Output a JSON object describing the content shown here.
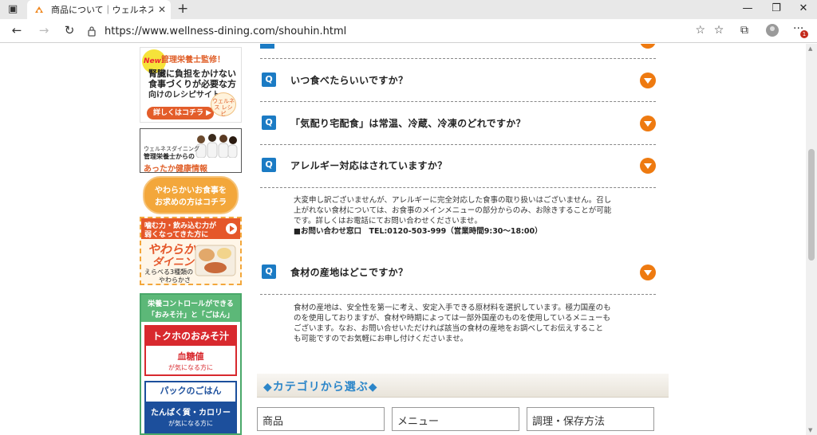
{
  "browser": {
    "tab_title": "商品について｜ウェルネスダイニング",
    "url": "https://www.wellness-dining.com/shouhin.html",
    "notification_count": "1"
  },
  "sidebar": {
    "banner1": {
      "new": "New!",
      "line1": "管理栄養士監修！",
      "line2": "腎臓に負担をかけない",
      "line3": "食事づくりが必要な方",
      "line4": "向けのレシピサイト",
      "button": "詳しくはコチラ ▶",
      "logo": "ウェルネス レシピ"
    },
    "banner2": {
      "line1": "ウェルネスダイニング",
      "line2": "管理栄養士からの",
      "line3": "あったか健康情報"
    },
    "banner3": {
      "line1": "やわらかいお食事を",
      "line2": "お求めの方はコチラ"
    },
    "banner4": {
      "head1": "噛む力・飲み込む力が",
      "head2": "弱くなってきた方に",
      "big1": "やわらか",
      "big2": "ダイニング",
      "sub1": "えらべる3種類の",
      "sub2": "やわらかさ"
    },
    "banner5": {
      "head1": "栄養コントロールができる",
      "head2": "「おみそ汁」と「ごはん」",
      "red_title": "トクホのおみそ汁",
      "red_line1": "血糖値",
      "red_line2": "が気になる方に",
      "blue_title": "パックのごはん",
      "blue_line1": "たんぱく質・カロリー",
      "blue_line2": "が気になる方に"
    }
  },
  "faq": {
    "q_label": "Q",
    "items": [
      {
        "question": "いつ食べたらいいですか？"
      },
      {
        "question": "「気配り宅配食」は常温、冷蔵、冷凍のどれですか？"
      },
      {
        "question": "アレルギー対応はされていますか？",
        "answer_l1": "大変申し訳ございませんが、アレルギーに完全対応した食事の取り扱いはございません。召し",
        "answer_l2": "上がれない食材については、お食事のメインメニューの部分からのみ、お除きすることが可能",
        "answer_l3": "です。詳しくはお電話にてお問い合わせくださいませ。",
        "contact": "■お問い合わせ窓口　TEL:0120-503-999（営業時間9:30～18:00）"
      },
      {
        "question": "食材の産地はどこですか？",
        "answer_l1": "食材の産地は、安全性を第一に考え、安定入手できる原材料を選択しています。極力国産のも",
        "answer_l2": "のを使用しておりますが、食材や時期によっては一部外国産のものを使用しているメニューも",
        "answer_l3": "ございます。なお、お問い合せいただければ該当の食材の産地をお調べしてお伝えすること",
        "answer_l4": "も可能ですのでお気軽にお申し付けくださいませ。"
      }
    ]
  },
  "category": {
    "title": "◆カテゴリから選ぶ◆",
    "boxes": [
      "商品",
      "メニュー",
      "調理・保存方法"
    ]
  }
}
